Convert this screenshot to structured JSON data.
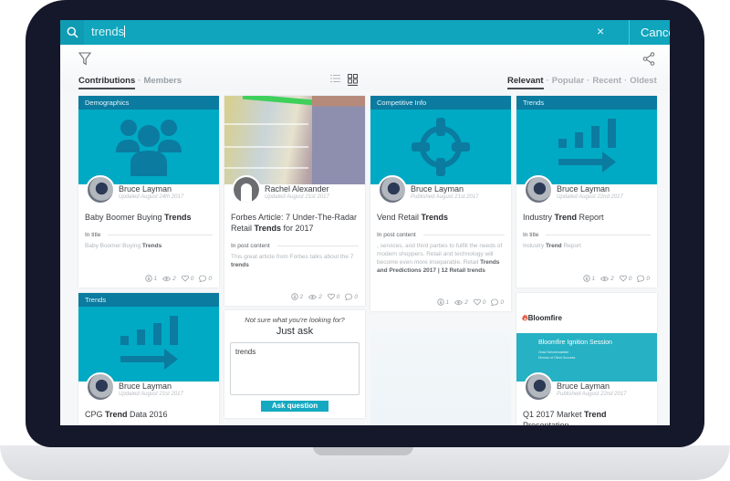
{
  "search": {
    "query": "trends",
    "clear_label": "×",
    "cancel_label": "Cancel"
  },
  "toolbar": {
    "tabs": [
      {
        "label": "Contributions",
        "active": true
      },
      {
        "label": "Members",
        "active": false
      }
    ],
    "separator": "·",
    "sort_options": [
      {
        "label": "Relevant",
        "active": true
      },
      {
        "label": "Popular",
        "active": false
      },
      {
        "label": "Recent",
        "active": false
      },
      {
        "label": "Oldest",
        "active": false
      }
    ],
    "view_modes": [
      "list-view",
      "grid-view"
    ],
    "active_view": "grid-view"
  },
  "colors": {
    "accent": "#10a5bd",
    "category_bar": "#0b7ba0",
    "hero_bg": "#00aac4",
    "hero_icon": "#0b7ba0",
    "bezel": "#15182a"
  },
  "cards": [
    {
      "category": "Demographics",
      "icon": "people-group-icon",
      "author": "Bruce Layman",
      "date": "Updated August 24th 2017",
      "title_pre": "Baby Boomer Buying ",
      "title_hl": "Trends",
      "title_post": "",
      "match_label": "In title",
      "match_pre": "Baby Boomer Buying ",
      "match_hl": "Trends",
      "match_post": "",
      "stats": {
        "downloads": "1",
        "views": "2",
        "likes": "0",
        "comments": "0"
      }
    },
    {
      "category": "",
      "icon": "grocery-photo",
      "author": "Rachel Alexander",
      "date": "Updated August 21st 2017",
      "title_pre": "Forbes Article: 7 Under-The-Radar Retail ",
      "title_hl": "Trends",
      "title_post": " for 2017",
      "match_label": "In post content",
      "match_pre": "This great article from Forbes talks about the 7 ",
      "match_hl": "trends",
      "match_post": "",
      "stats": {
        "downloads": "2",
        "views": "2",
        "likes": "0",
        "comments": "0"
      }
    },
    {
      "category": "Competitive Info",
      "icon": "crosshair-target-icon",
      "author": "Bruce Layman",
      "date": "Published August 21st 2017",
      "title_pre": "Vend Retail ",
      "title_hl": "Trends",
      "title_post": "",
      "match_label": "In post content",
      "match_pre": ", services, and third parties to fulfill the needs of modern shoppers. Retail and technology will become even more inseparable. Retail ",
      "match_hl": "Trends and Predictions 2017 | 12 Retail trends",
      "match_post": "",
      "stats": {
        "downloads": "1",
        "views": "2",
        "likes": "0",
        "comments": "0"
      }
    },
    {
      "category": "Trends",
      "icon": "bar-chart-arrow-icon",
      "author": "Bruce Layman",
      "date": "Updated August 22nd 2017",
      "title_pre": "Industry ",
      "title_hl": "Trend",
      "title_post": " Report",
      "match_label": "In title",
      "match_pre": "Industry ",
      "match_hl": "Trend",
      "match_post": " Report",
      "stats": {
        "downloads": "1",
        "views": "2",
        "likes": "0",
        "comments": "0"
      }
    },
    {
      "category": "Trends",
      "icon": "bar-chart-arrow-icon",
      "author": "Bruce Layman",
      "date": "Updated August 21st 2017",
      "title_pre": "CPG ",
      "title_hl": "Trend",
      "title_post": " Data 2016"
    },
    {
      "category": "",
      "icon": "presentation-slide",
      "slide_logo": "Bloomfire",
      "slide_title": "Bloomfire Ignition Session",
      "slide_subtitle_1": "Chad Schoenwaelder",
      "slide_subtitle_2": "Director of Client Success",
      "author": "Bruce Layman",
      "date": "Published August 22nd 2017",
      "title_pre": "Q1 2017 Market ",
      "title_hl": "Trend",
      "title_post": " Presentation"
    }
  ],
  "ask": {
    "prompt": "Not sure what you're looking for?",
    "heading": "Just ask",
    "input_value": "trends",
    "button_label": "Ask question"
  }
}
